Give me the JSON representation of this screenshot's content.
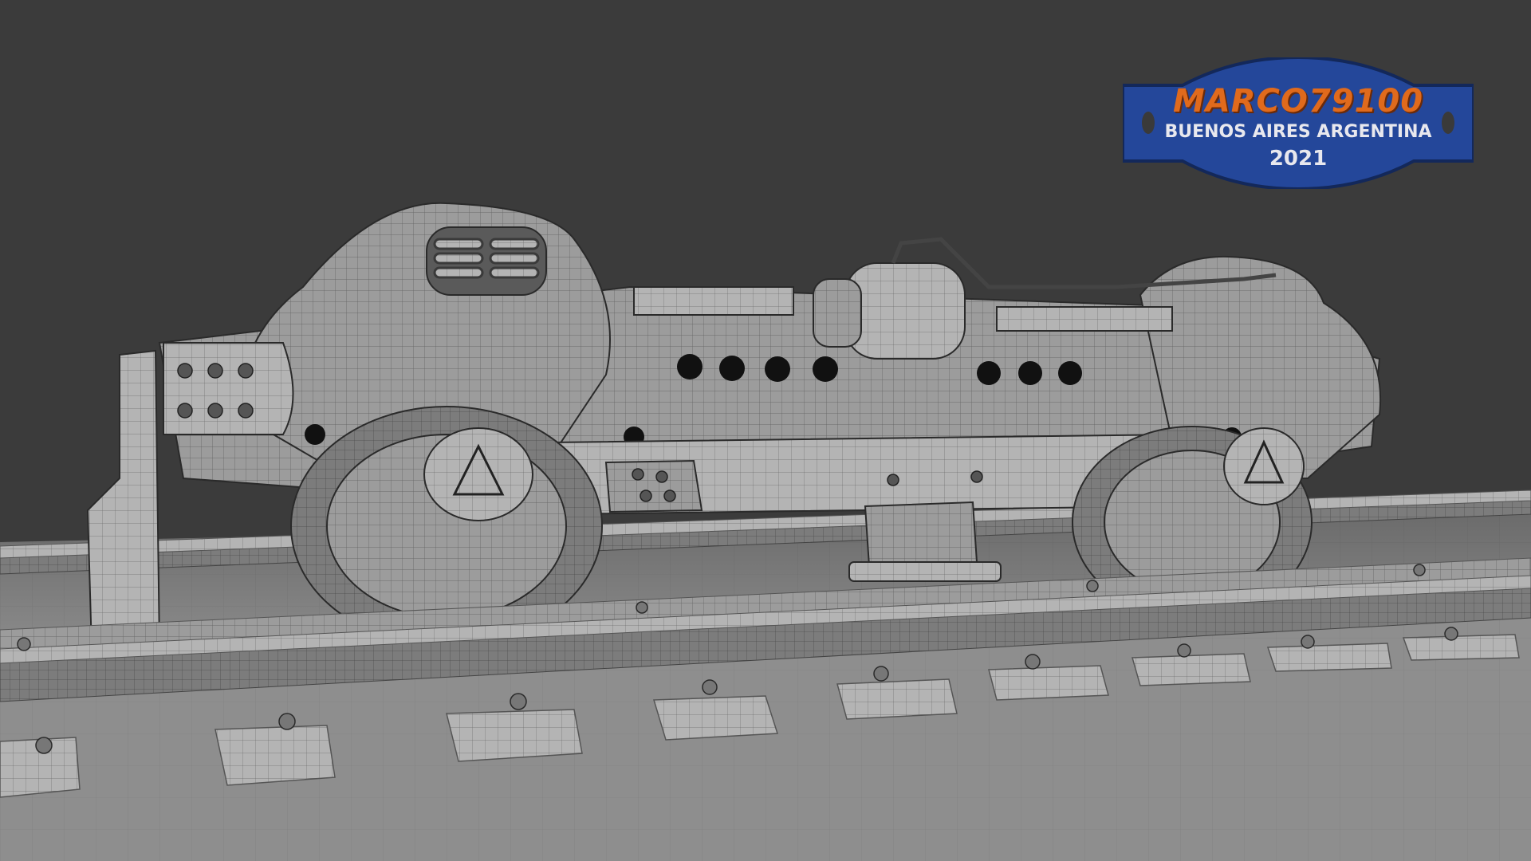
{
  "badge": {
    "name": "MARCO79100",
    "city": "BUENOS AIRES ARGENTINA",
    "year": "2021"
  },
  "scene": {
    "subject": "wireframe render of a locomotive bogie on railway track",
    "colors": {
      "background": "#3b3b3b",
      "model": "#9a9a9a",
      "badge_fill": "#24479a",
      "badge_text_accent": "#e06a1c"
    }
  }
}
